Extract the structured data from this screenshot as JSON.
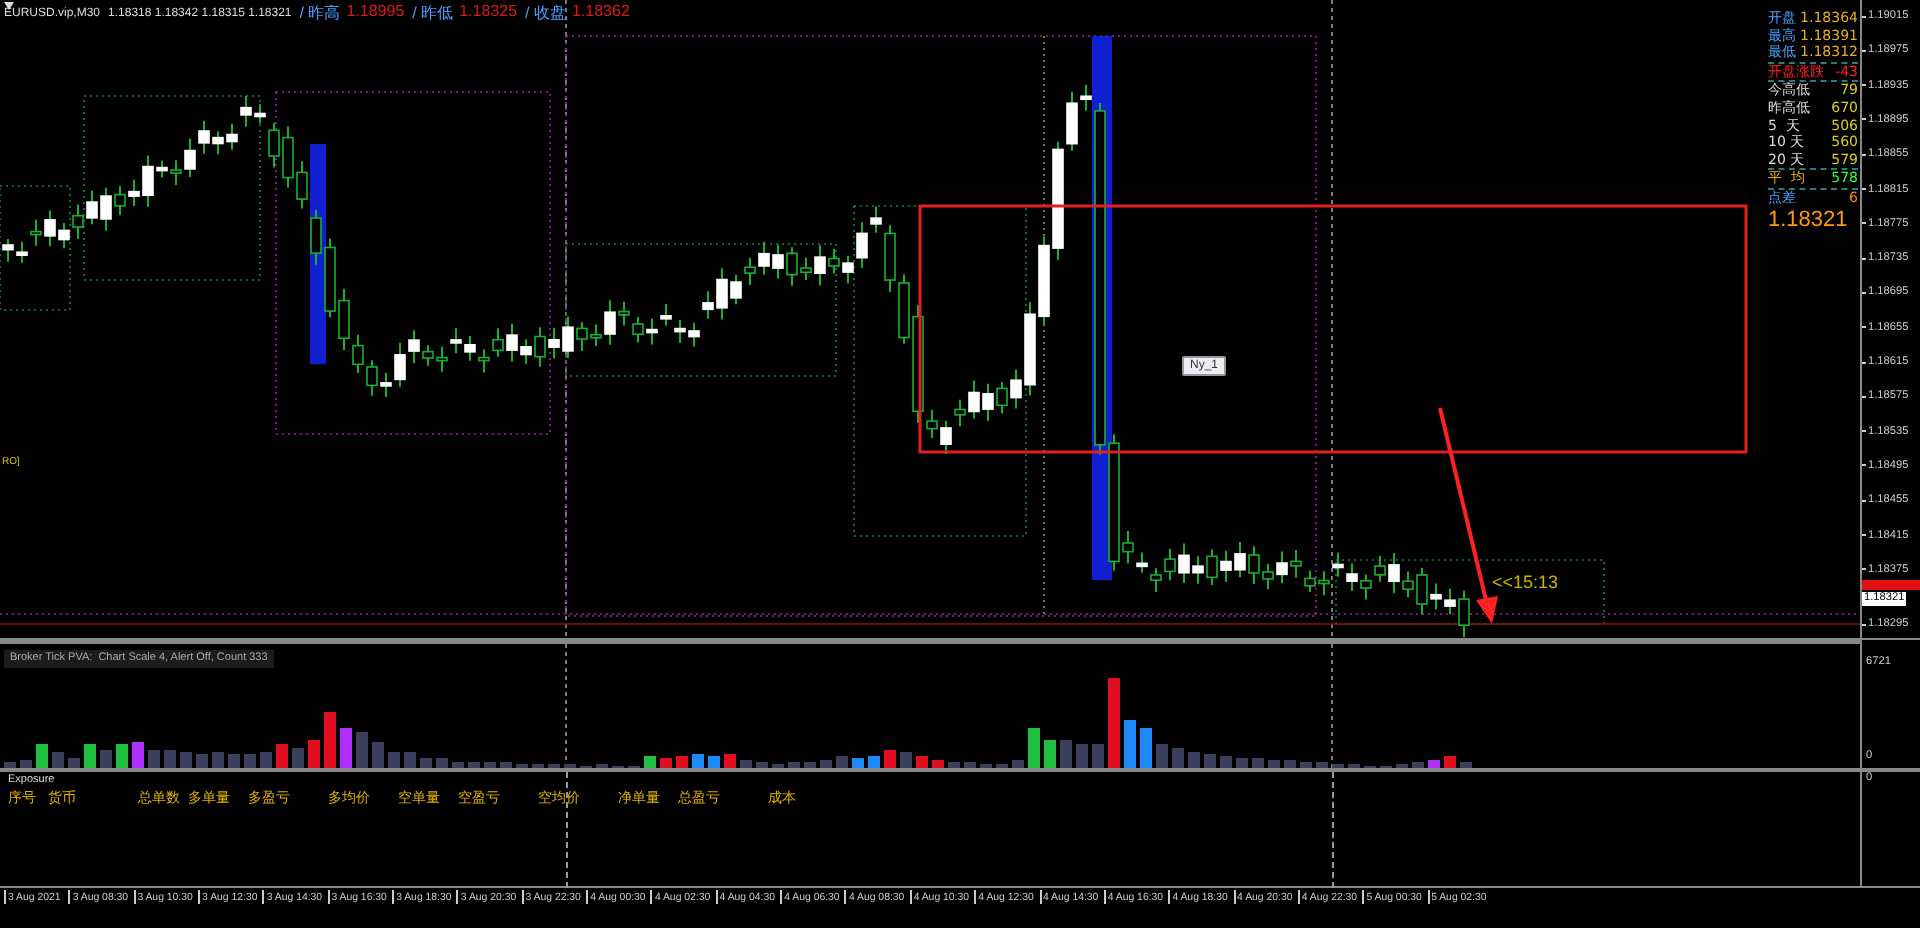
{
  "header": {
    "symbol": "EURUSD.vip,M30",
    "quote": "1.18318 1.18342 1.18315 1.18321",
    "stats": [
      {
        "label": "/ 昨高",
        "value": "1.18995"
      },
      {
        "label": "/ 昨低",
        "value": "1.18325"
      },
      {
        "label": "/ 收盘",
        "value": "1.18362"
      }
    ]
  },
  "info_panel": {
    "rows": [
      {
        "label": "开盘",
        "value": "1.18364",
        "kind": "price"
      },
      {
        "label": "最高",
        "value": "1.18391",
        "kind": "price"
      },
      {
        "label": "最低",
        "value": "1.18312",
        "kind": "price"
      },
      {
        "label": "开盘涨跌",
        "value": "-43",
        "kind": "alert"
      },
      {
        "label": "今高低",
        "value": "79",
        "kind": "plain"
      },
      {
        "label": "昨高低",
        "value": "670",
        "kind": "plain"
      },
      {
        "label": "5  天",
        "value": "506",
        "kind": "plain"
      },
      {
        "label": "10 天",
        "value": "560",
        "kind": "plain"
      },
      {
        "label": "20 天",
        "value": "579",
        "kind": "plain"
      },
      {
        "label": "平  均",
        "value": "578",
        "kind": "average"
      },
      {
        "label": "点差",
        "value": "6",
        "kind": "spread"
      }
    ],
    "price": "1.18321"
  },
  "chart": {
    "label_box": "Ny_1",
    "countdown": "<<15:13",
    "side_label": "RO]"
  },
  "price_axis": {
    "ticks": [
      "1.19015",
      "1.18975",
      "1.18935",
      "1.18895",
      "1.18855",
      "1.18815",
      "1.18775",
      "1.18735",
      "1.18695",
      "1.18655",
      "1.18615",
      "1.18575",
      "1.18535",
      "1.18495",
      "1.18455",
      "1.18415",
      "1.18375",
      "1.18295"
    ],
    "current": "1.18321"
  },
  "indicator": {
    "title": "Broker Tick PVA:  Chart Scale 4, Alert Off, Count 333",
    "axis_max": "6721",
    "axis_zero": "0"
  },
  "exposure": {
    "title": "Exposure",
    "axis_zero": "0",
    "columns": [
      "序号",
      "货币",
      "总单数",
      "多单量",
      "多盈亏",
      "多均价",
      "空单量",
      "空盈亏",
      "空均价",
      "净单量",
      "总盈亏",
      "成本"
    ]
  },
  "time_axis": {
    "labels": [
      "3 Aug 2021",
      "3 Aug 08:30",
      "3 Aug 10:30",
      "3 Aug 12:30",
      "3 Aug 14:30",
      "3 Aug 16:30",
      "3 Aug 18:30",
      "3 Aug 20:30",
      "3 Aug 22:30",
      "4 Aug 00:30",
      "4 Aug 02:30",
      "4 Aug 04:30",
      "4 Aug 06:30",
      "4 Aug 08:30",
      "4 Aug 10:30",
      "4 Aug 12:30",
      "4 Aug 14:30",
      "4 Aug 16:30",
      "4 Aug 18:30",
      "4 Aug 20:30",
      "4 Aug 22:30",
      "5 Aug 00:30",
      "5 Aug 02:30"
    ]
  }
}
